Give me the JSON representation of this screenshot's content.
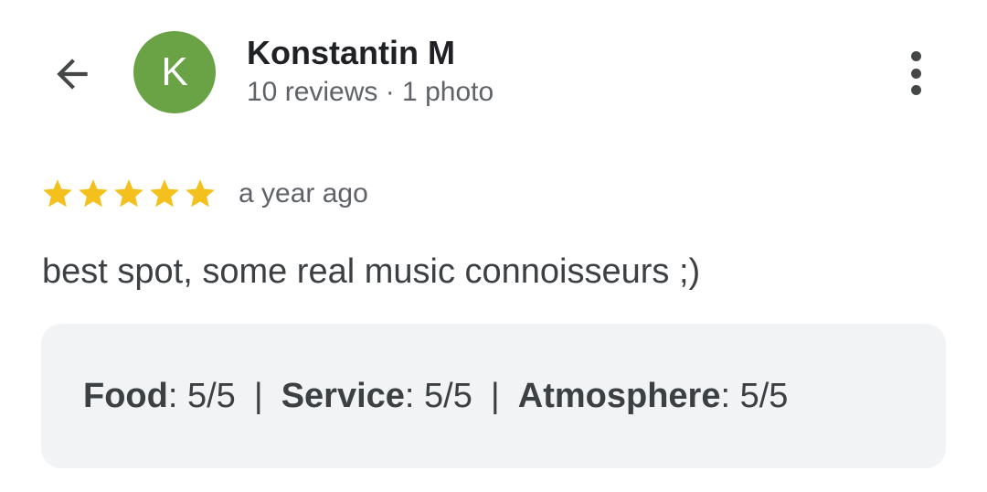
{
  "header": {
    "back_icon": "arrow-back-icon",
    "avatar_letter": "K",
    "avatar_color": "#6aa246",
    "user_name": "Konstantin M",
    "user_meta": "10 reviews · 1 photo",
    "more_icon": "more-vert-icon"
  },
  "review": {
    "rating": 5,
    "rating_max": 5,
    "star_color": "#f4c01e",
    "time_ago": "a year ago",
    "text": "best spot, some real music connoisseurs ;)"
  },
  "attributes": [
    {
      "label": "Food",
      "value": ": 5/5"
    },
    {
      "label": "Service",
      "value": ": 5/5"
    },
    {
      "label": "Atmosphere",
      "value": ": 5/5"
    }
  ],
  "attributes_separator": "|"
}
